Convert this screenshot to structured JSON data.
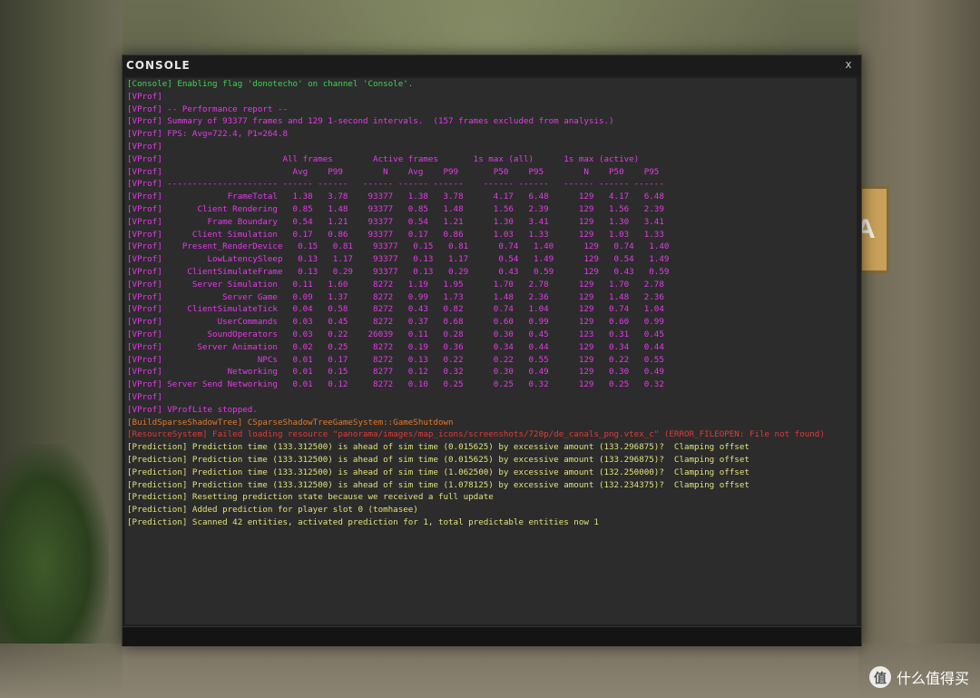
{
  "window": {
    "title": "CONSOLE",
    "close_label": "x"
  },
  "input": {
    "value": ""
  },
  "lines": [
    {
      "color": "green",
      "text": "[Console] Enabling flag 'donotecho' on channel 'Console'."
    },
    {
      "color": "magenta",
      "text": "[VProf]"
    },
    {
      "color": "magenta",
      "text": "[VProf] -- Performance report --"
    },
    {
      "color": "magenta",
      "text": "[VProf] Summary of 93377 frames and 129 1-second intervals.  (157 frames excluded from analysis.)"
    },
    {
      "color": "magenta",
      "text": "[VProf] FPS: Avg=722.4, P1=264.8"
    },
    {
      "color": "magenta",
      "text": "[VProf]"
    },
    {
      "color": "magenta",
      "text": "[VProf]                        All frames        Active frames       1s max (all)      1s max (active)"
    },
    {
      "color": "magenta",
      "text": "[VProf]                          Avg    P99        N    Avg    P99       P50    P95        N    P50    P95"
    },
    {
      "color": "magenta",
      "text": "[VProf] ---------------------- ------ ------   ------ ------ ------    ------ ------   ------ ------ ------"
    },
    {
      "color": "magenta",
      "text": "[VProf]             FrameTotal   1.38   3.78    93377   1.38   3.78      4.17   6.48      129   4.17   6.48"
    },
    {
      "color": "magenta",
      "text": "[VProf]       Client Rendering   0.85   1.48    93377   0.85   1.48      1.56   2.39      129   1.56   2.39"
    },
    {
      "color": "magenta",
      "text": "[VProf]         Frame Boundary   0.54   1.21    93377   0.54   1.21      1.30   3.41      129   1.30   3.41"
    },
    {
      "color": "magenta",
      "text": "[VProf]      Client Simulation   0.17   0.86    93377   0.17   0.86      1.03   1.33      129   1.03   1.33"
    },
    {
      "color": "magenta",
      "text": "[VProf]    Present_RenderDevice   0.15   0.81    93377   0.15   0.81      0.74   1.40      129   0.74   1.40"
    },
    {
      "color": "magenta",
      "text": "[VProf]         LowLatencySleep   0.13   1.17    93377   0.13   1.17      0.54   1.49      129   0.54   1.49"
    },
    {
      "color": "magenta",
      "text": "[VProf]     ClientSimulateFrame   0.13   0.29    93377   0.13   0.29      0.43   0.59      129   0.43   0.59"
    },
    {
      "color": "magenta",
      "text": "[VProf]      Server Simulation   0.11   1.60     8272   1.19   1.95      1.70   2.78      129   1.70   2.78"
    },
    {
      "color": "magenta",
      "text": "[VProf]            Server Game   0.09   1.37     8272   0.99   1.73      1.48   2.36      129   1.48   2.36"
    },
    {
      "color": "magenta",
      "text": "[VProf]     ClientSimulateTick   0.04   0.58     8272   0.43   0.82      0.74   1.04      129   0.74   1.04"
    },
    {
      "color": "magenta",
      "text": "[VProf]           UserCommands   0.03   0.45     8272   0.37   0.68      0.60   0.99      129   0.60   0.99"
    },
    {
      "color": "magenta",
      "text": "[VProf]         SoundOperators   0.03   0.22    26039   0.11   0.28      0.30   0.45      123   0.31   0.45"
    },
    {
      "color": "magenta",
      "text": "[VProf]       Server Animation   0.02   0.25     8272   0.19   0.36      0.34   0.44      129   0.34   0.44"
    },
    {
      "color": "magenta",
      "text": "[VProf]                   NPCs   0.01   0.17     8272   0.13   0.22      0.22   0.55      129   0.22   0.55"
    },
    {
      "color": "magenta",
      "text": "[VProf]             Networking   0.01   0.15     8277   0.12   0.32      0.30   0.49      129   0.30   0.49"
    },
    {
      "color": "magenta",
      "text": "[VProf] Server Send Networking   0.01   0.12     8272   0.10   0.25      0.25   0.32      129   0.25   0.32"
    },
    {
      "color": "magenta",
      "text": "[VProf]"
    },
    {
      "color": "magenta",
      "text": "[VProf] VProfLite stopped."
    },
    {
      "color": "orange",
      "text": "[BuildSparseShadowTree] CSparseShadowTreeGameSystem::GameShutdown"
    },
    {
      "color": "red",
      "text": "[ResourceSystem] Failed loading resource \"panorama/images/map_icons/screenshots/720p/de_canals_png.vtex_c\" (ERROR_FILEOPEN: File not found)"
    },
    {
      "color": "yellow",
      "text": "[Prediction] Prediction time (133.312500) is ahead of sim time (0.015625) by excessive amount (133.296875)?  Clamping offset"
    },
    {
      "color": "yellow",
      "text": "[Prediction] Prediction time (133.312500) is ahead of sim time (0.015625) by excessive amount (133.296875)?  Clamping offset"
    },
    {
      "color": "yellow",
      "text": "[Prediction] Prediction time (133.312500) is ahead of sim time (1.062500) by excessive amount (132.250000)?  Clamping offset"
    },
    {
      "color": "yellow",
      "text": "[Prediction] Prediction time (133.312500) is ahead of sim time (1.078125) by excessive amount (132.234375)?  Clamping offset"
    },
    {
      "color": "yellow",
      "text": "[Prediction] Resetting prediction state because we received a full update"
    },
    {
      "color": "yellow",
      "text": "[Prediction] Added prediction for player slot 0 (tomhasee)"
    },
    {
      "color": "yellow",
      "text": "[Prediction] Scanned 42 entities, activated prediction for 1, total predictable entities now 1"
    }
  ],
  "watermark": {
    "icon_char": "值",
    "text": "什么值得买"
  },
  "scene": {
    "sign_letter": "A"
  },
  "colors": {
    "green": "#3fd44f",
    "magenta": "#e43ae8",
    "orange": "#e0782a",
    "red": "#e03a3a",
    "yellow": "#dfe27a"
  }
}
